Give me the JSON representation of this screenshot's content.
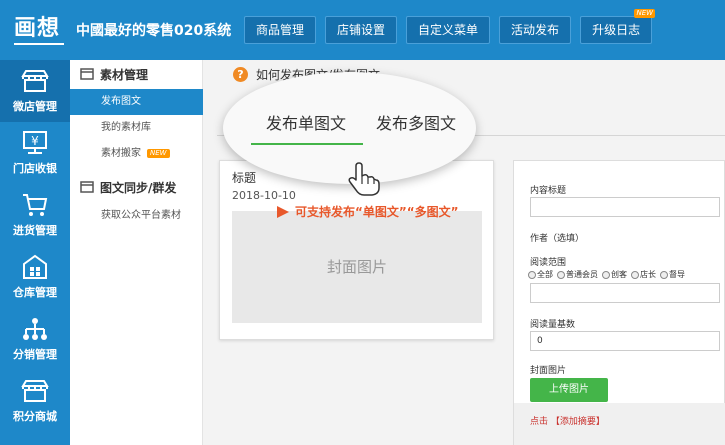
{
  "header": {
    "logo_text": "画想",
    "site_title": "中國最好的零售020系统",
    "nav": [
      {
        "label": "商品管理"
      },
      {
        "label": "店铺设置"
      },
      {
        "label": "自定义菜单"
      },
      {
        "label": "活动发布"
      },
      {
        "label": "升级日志",
        "badge": "NEW"
      }
    ]
  },
  "sidebar": {
    "items": [
      {
        "label": "微店管理",
        "icon": "shop-icon"
      },
      {
        "label": "门店收银",
        "icon": "cashier-icon"
      },
      {
        "label": "进货管理",
        "icon": "cart-icon"
      },
      {
        "label": "仓库管理",
        "icon": "warehouse-icon"
      },
      {
        "label": "分销管理",
        "icon": "distribution-icon"
      },
      {
        "label": "积分商城",
        "icon": "points-mall-icon"
      }
    ]
  },
  "submenu": {
    "group1_title": "素材管理",
    "group1_items": [
      {
        "label": "发布图文"
      },
      {
        "label": "我的素材库"
      },
      {
        "label": "素材搬家",
        "badge": "NEW"
      }
    ],
    "group2_title": "图文同步/群发",
    "group2_items": [
      {
        "label": "获取公众平台素材"
      }
    ]
  },
  "main": {
    "help_text": "如何发布图文/发布图文",
    "tab_stub": "发",
    "lens_tabs": [
      {
        "label": "发布单图文"
      },
      {
        "label": "发布多图文"
      }
    ],
    "callout": "可支持发布“单图文”“多图文”",
    "preview": {
      "title": "标题",
      "date": "2018-10-10",
      "cover_label": "封面图片"
    },
    "form": {
      "content_title_label": "内容标题",
      "author_label": "作者（选填）",
      "scope_label": "阅读范围",
      "scope_options": [
        "全部",
        "普通会员",
        "创客",
        "店长",
        "督导"
      ],
      "read_count_label": "阅读量基数",
      "read_count_value": "0",
      "cover_label": "封面图片",
      "upload_label": "上传图片",
      "abstract_prefix": "点击",
      "abstract_link": "【添加摘要】"
    }
  },
  "colors": {
    "primary_blue": "#1e88c9",
    "dark_blue": "#1570ad",
    "accent_green": "#44b549",
    "callout_orange": "#e8582b"
  }
}
